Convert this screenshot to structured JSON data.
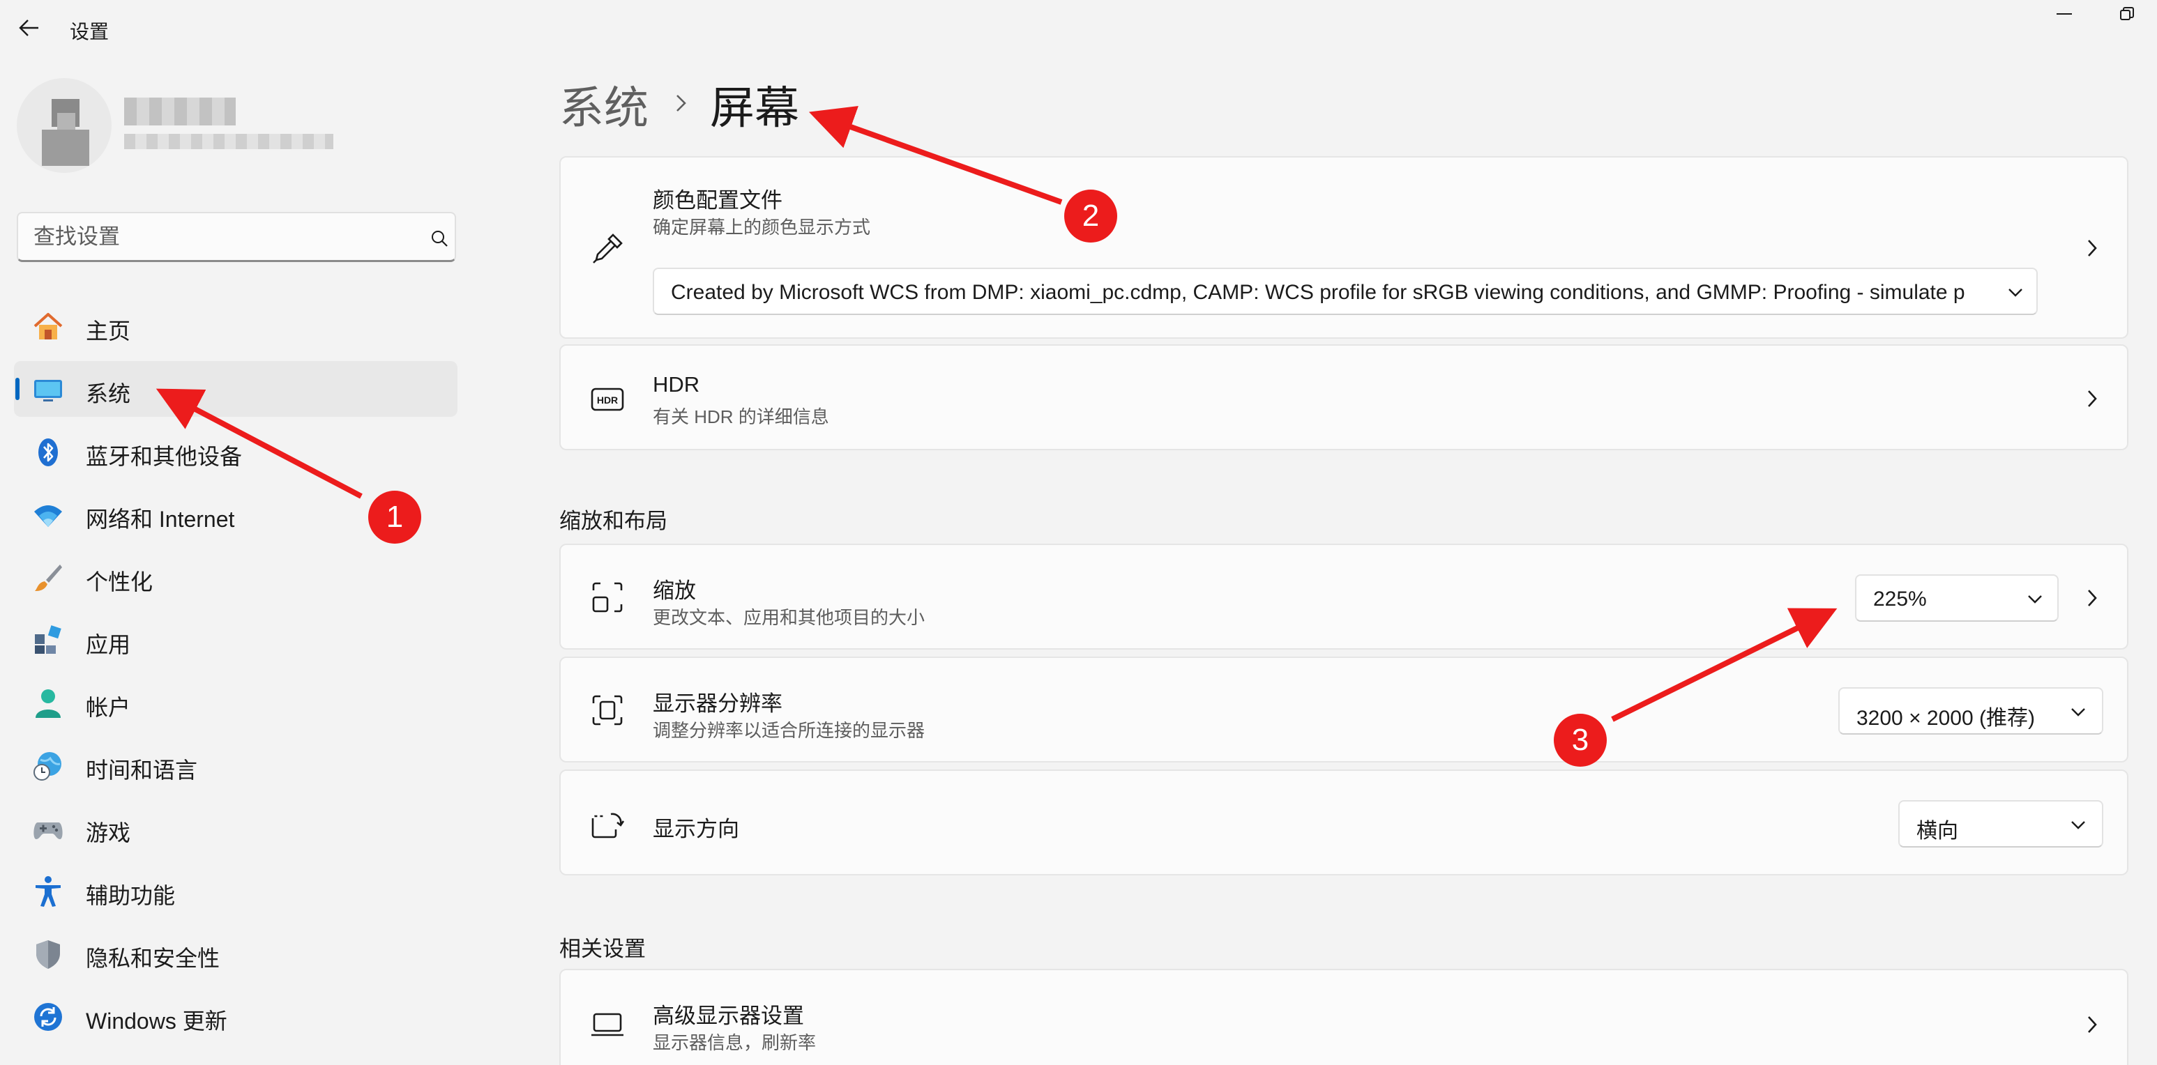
{
  "titlebar": {
    "title": "设置"
  },
  "search": {
    "placeholder": "查找设置"
  },
  "sidebar": {
    "items": [
      {
        "label": "主页",
        "icon": "home-icon"
      },
      {
        "label": "系统",
        "icon": "display-icon",
        "active": true
      },
      {
        "label": "蓝牙和其他设备",
        "icon": "bluetooth-icon"
      },
      {
        "label": "网络和 Internet",
        "icon": "wifi-icon"
      },
      {
        "label": "个性化",
        "icon": "brush-icon"
      },
      {
        "label": "应用",
        "icon": "apps-icon"
      },
      {
        "label": "帐户",
        "icon": "account-icon"
      },
      {
        "label": "时间和语言",
        "icon": "clock-globe-icon"
      },
      {
        "label": "游戏",
        "icon": "gamepad-icon"
      },
      {
        "label": "辅助功能",
        "icon": "accessibility-icon"
      },
      {
        "label": "隐私和安全性",
        "icon": "shield-icon"
      },
      {
        "label": "Windows 更新",
        "icon": "update-icon"
      }
    ]
  },
  "breadcrumb": {
    "parent": "系统",
    "current": "屏幕"
  },
  "color_profile": {
    "title": "颜色配置文件",
    "subtitle": "确定屏幕上的颜色显示方式",
    "selected": "Created by Microsoft WCS from DMP: xiaomi_pc.cdmp, CAMP: WCS profile for sRGB viewing conditions, and GMMP: Proofing - simulate p"
  },
  "hdr": {
    "title": "HDR",
    "link": "有关 HDR 的详细信息"
  },
  "scale_layout": {
    "section_title": "缩放和布局",
    "scale": {
      "title": "缩放",
      "subtitle": "更改文本、应用和其他项目的大小",
      "value": "225%"
    },
    "resolution": {
      "title": "显示器分辨率",
      "subtitle": "调整分辨率以适合所连接的显示器",
      "value": "3200 × 2000 (推荐)"
    },
    "orientation": {
      "title": "显示方向",
      "value": "横向"
    }
  },
  "related": {
    "section_title": "相关设置",
    "advanced_display": {
      "title": "高级显示器设置",
      "subtitle": "显示器信息，刷新率"
    }
  },
  "annotations": {
    "badge1": "1",
    "badge2": "2",
    "badge3": "3",
    "color": "#ec1c1c"
  },
  "colors": {
    "accent": "#0067c0",
    "link": "#003e92",
    "annotation": "#ec1c1c"
  }
}
